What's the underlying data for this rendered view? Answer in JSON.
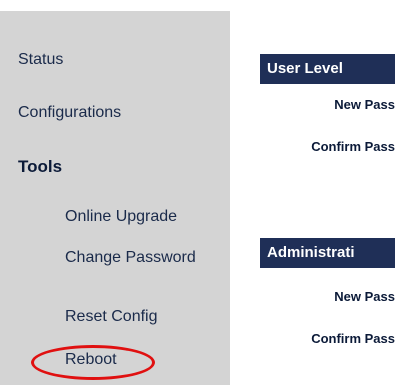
{
  "sidebar": {
    "items": [
      {
        "label": "Status"
      },
      {
        "label": "Configurations"
      }
    ],
    "section_heading": "Tools",
    "tools_items": [
      {
        "label": "Online Upgrade"
      },
      {
        "label": "Change Password"
      },
      {
        "label": "Reset Config"
      },
      {
        "label": "Reboot"
      }
    ],
    "highlight_color": "#e01010"
  },
  "main": {
    "user_level": {
      "title": "User Level",
      "new_pass_label": "New Pass",
      "confirm_pass_label": "Confirm Pass"
    },
    "administration": {
      "title": "Administrati",
      "new_pass_label": "New Pass",
      "confirm_pass_label": "Confirm Pass"
    },
    "header_color": "#1f2f57"
  }
}
